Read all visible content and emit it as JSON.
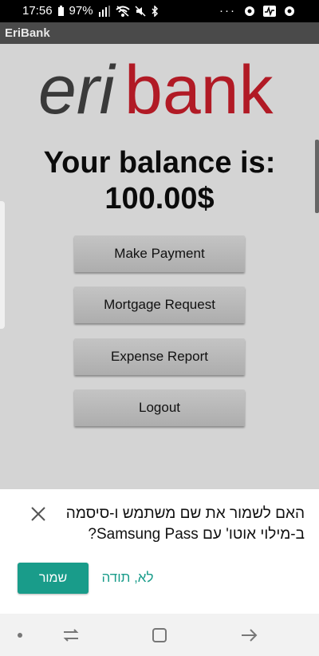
{
  "status_bar": {
    "time": "17:56",
    "battery": "97%"
  },
  "app": {
    "title": "EriBank"
  },
  "logo": {
    "text_eri": "eri",
    "text_bank": "bank",
    "eri_color": "#3a3a3a",
    "bank_color": "#b11a25"
  },
  "balance": {
    "line1": "Your balance is:",
    "line2": "100.00$"
  },
  "buttons": {
    "make_payment": "Make Payment",
    "mortgage_request": "Mortgage Request",
    "expense_report": "Expense Report",
    "logout": "Logout"
  },
  "autofill_prompt": {
    "message": "האם לשמור את שם משתמש ו-סיסמה ב-מילוי אוטו' עם Samsung Pass?",
    "save_label": "שמור",
    "no_thanks_label": "לא, תודה",
    "accent_color": "#199c8a"
  },
  "navbar": {
    "icons": [
      "dot-icon",
      "recents-icon",
      "home-icon",
      "back-icon"
    ]
  }
}
